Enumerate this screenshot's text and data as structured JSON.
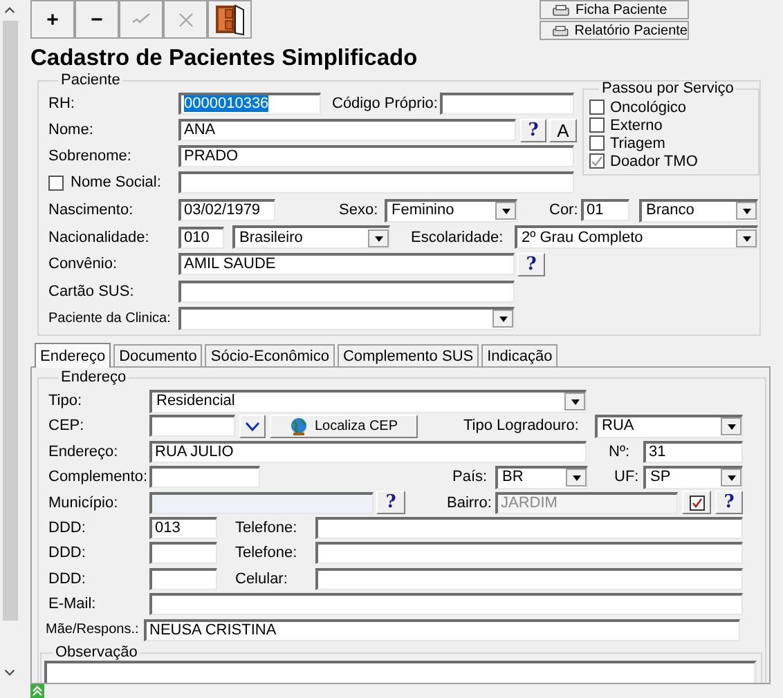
{
  "toolbar": [
    {
      "kind": "add",
      "label": "+",
      "disabled": false
    },
    {
      "kind": "remove",
      "label": "−",
      "disabled": false
    },
    {
      "kind": "confirm",
      "disabled": true
    },
    {
      "kind": "cancel",
      "disabled": true
    },
    {
      "kind": "exit",
      "disabled": false
    }
  ],
  "report_buttons": [
    {
      "label": "Ficha Paciente"
    },
    {
      "label": "Relatório Paciente"
    }
  ],
  "title": "Cadastro de Pacientes Simplificado",
  "paciente": {
    "legend": "Paciente",
    "rh": {
      "label": "RH:",
      "value": "0000010336",
      "selected": true
    },
    "codigo_proprio": {
      "label": "Código Próprio:"
    },
    "nome": {
      "label": "Nome:",
      "value": "ANA",
      "buttons": [
        "?",
        "A"
      ]
    },
    "sobrenome": {
      "label": "Sobrenome:",
      "value": "PRADO"
    },
    "nome_social": {
      "label": "Nome Social:",
      "checked": false
    },
    "nascimento": {
      "label": "Nascimento:",
      "value": "03/02/1979"
    },
    "sexo": {
      "label": "Sexo:",
      "value": "Feminino"
    },
    "cor": {
      "label": "Cor:",
      "code": "01",
      "value": "Branco"
    },
    "nacionalidade": {
      "label": "Nacionalidade:",
      "code": "010",
      "value": "Brasileiro"
    },
    "escolaridade": {
      "label": "Escolaridade:",
      "value": "2º Grau Completo"
    },
    "convenio": {
      "label": "Convênio:",
      "value": "AMIL SAUDE",
      "button": "?"
    },
    "cartao_sus": {
      "label": "Cartão SUS:"
    },
    "paciente_clinica": {
      "label": "Paciente da Clinica:"
    },
    "servicos": {
      "legend": "Passou por Serviço",
      "items": [
        {
          "label": "Oncológico",
          "checked": false
        },
        {
          "label": "Externo",
          "checked": false
        },
        {
          "label": "Triagem",
          "checked": false
        },
        {
          "label": "Doador TMO",
          "checked": true
        }
      ]
    }
  },
  "tabs": [
    {
      "label": "Endereço",
      "selected": true
    },
    {
      "label": "Documento",
      "selected": false
    },
    {
      "label": "Sócio-Econômico",
      "selected": false
    },
    {
      "label": "Complemento SUS",
      "selected": false
    },
    {
      "label": "Indicação",
      "selected": false
    }
  ],
  "endereco": {
    "legend": "Endereço",
    "tipo": {
      "label": "Tipo:",
      "value": "Residencial"
    },
    "cep": {
      "label": "CEP:",
      "button": "Localiza CEP"
    },
    "tipo_logradouro": {
      "label": "Tipo Logradouro:",
      "value": "RUA"
    },
    "endereco": {
      "label": "Endereço:",
      "value": "RUA JULIO"
    },
    "numero": {
      "label": "Nº:",
      "value": "31"
    },
    "complemento": {
      "label": "Complemento:"
    },
    "pais": {
      "label": "País:",
      "value": "BR"
    },
    "uf": {
      "label": "UF:",
      "value": "SP"
    },
    "municipio": {
      "label": "Município:",
      "button": "?"
    },
    "bairro": {
      "label": "Bairro:",
      "value": "JARDIM",
      "disabled": true,
      "button": "?"
    },
    "phones": [
      {
        "ddd_label": "DDD:",
        "ddd": "013",
        "label": "Telefone:"
      },
      {
        "ddd_label": "DDD:",
        "label": "Telefone:"
      },
      {
        "ddd_label": "DDD:",
        "label": "Celular:"
      }
    ],
    "email": {
      "label": "E-Mail:"
    },
    "responsavel": {
      "label": "Mãe/Respons.:",
      "value": "NEUSA CRISTINA"
    },
    "observacao": {
      "legend": "Observação"
    }
  }
}
